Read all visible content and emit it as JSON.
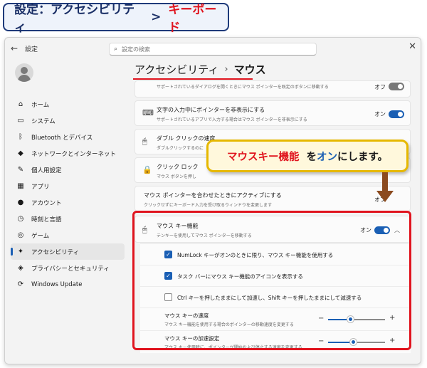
{
  "title_badge": {
    "main": "設定：アクセシビリティ",
    "separator": ">",
    "accent": "キーボード"
  },
  "window": {
    "app_title": "設定",
    "search_placeholder": "設定の検索",
    "close_glyph": "✕"
  },
  "sidebar": {
    "items": [
      {
        "label": "ホーム",
        "icon": "home-icon",
        "glyph": "⌂"
      },
      {
        "label": "システム",
        "icon": "system-icon",
        "glyph": "▭"
      },
      {
        "label": "Bluetooth とデバイス",
        "icon": "bluetooth-icon",
        "glyph": "ᛒ"
      },
      {
        "label": "ネットワークとインターネット",
        "icon": "network-icon",
        "glyph": "◆"
      },
      {
        "label": "個人用設定",
        "icon": "brush-icon",
        "glyph": "✎"
      },
      {
        "label": "アプリ",
        "icon": "apps-icon",
        "glyph": "▦"
      },
      {
        "label": "アカウント",
        "icon": "account-icon",
        "glyph": "●"
      },
      {
        "label": "時刻と言語",
        "icon": "clock-icon",
        "glyph": "◷"
      },
      {
        "label": "ゲーム",
        "icon": "gamepad-icon",
        "glyph": "◎"
      },
      {
        "label": "アクセシビリティ",
        "icon": "accessibility-icon",
        "glyph": "✦"
      },
      {
        "label": "プライバシーとセキュリティ",
        "icon": "shield-icon",
        "glyph": "◈"
      },
      {
        "label": "Windows Update",
        "icon": "update-icon",
        "glyph": "⟳"
      }
    ],
    "active_index": 9
  },
  "breadcrumb": {
    "parent": "アクセシビリティ",
    "separator": "›",
    "current": "マウス"
  },
  "cards": {
    "top": {
      "desc": "サポートされているダイアログを開くときにマウス ポインターを既定のボタンに移動する",
      "toggle": "オフ"
    },
    "hide_pointer": {
      "title": "文字の入力中にポインターを非表示にする",
      "desc": "サポートされているアプリで入力する場合はマウス ポインターを非表示にする",
      "toggle": "オン"
    },
    "double_click": {
      "title": "ダブル クリックの速度",
      "desc": "ダブルクリックするのに"
    },
    "click_lock": {
      "title": "クリック ロック",
      "desc": "マウス ボタンを押し"
    },
    "activate": {
      "title": "マウス ポインターを合わせたときにアクティブにする",
      "desc": "クリックせずにキーボード入力を受け取るウィンドウを変更します",
      "toggle": "オフ"
    },
    "mouse_keys": {
      "title": "マウス キー機能",
      "desc": "テンキーを使用してマウス ポインターを移動する",
      "toggle": "オン"
    }
  },
  "mouse_keys_options": {
    "numlock": {
      "label": "NumLock キーがオンのときに限り、マウス キー機能を使用する",
      "checked": true
    },
    "taskbar_icon": {
      "label": "タスク バーにマウス キー機能のアイコンを表示する",
      "checked": true
    },
    "ctrl_shift": {
      "label": "Ctrl キーを押したままにして加速し、Shift キーを押したままにして減速する",
      "checked": false
    },
    "speed": {
      "title": "マウス キーの速度",
      "desc": "マウス キー機能を使用する場合のポインターの移動速度を変更する",
      "value": 0.4
    },
    "acceleration": {
      "title": "マウス キーの加速設定",
      "desc": "マウス キー使用時に、ポインターが開始および停止する速度を変更する",
      "value": 0.45
    }
  },
  "callout": {
    "part1": "マウスキー機能",
    "part2": "を",
    "part3": "オン",
    "part4": "にします。"
  },
  "colors": {
    "accent": "#1a5fb4",
    "highlight": "#e0141e",
    "callout_border": "#e6b800",
    "arrow": "#8b4a1e"
  }
}
